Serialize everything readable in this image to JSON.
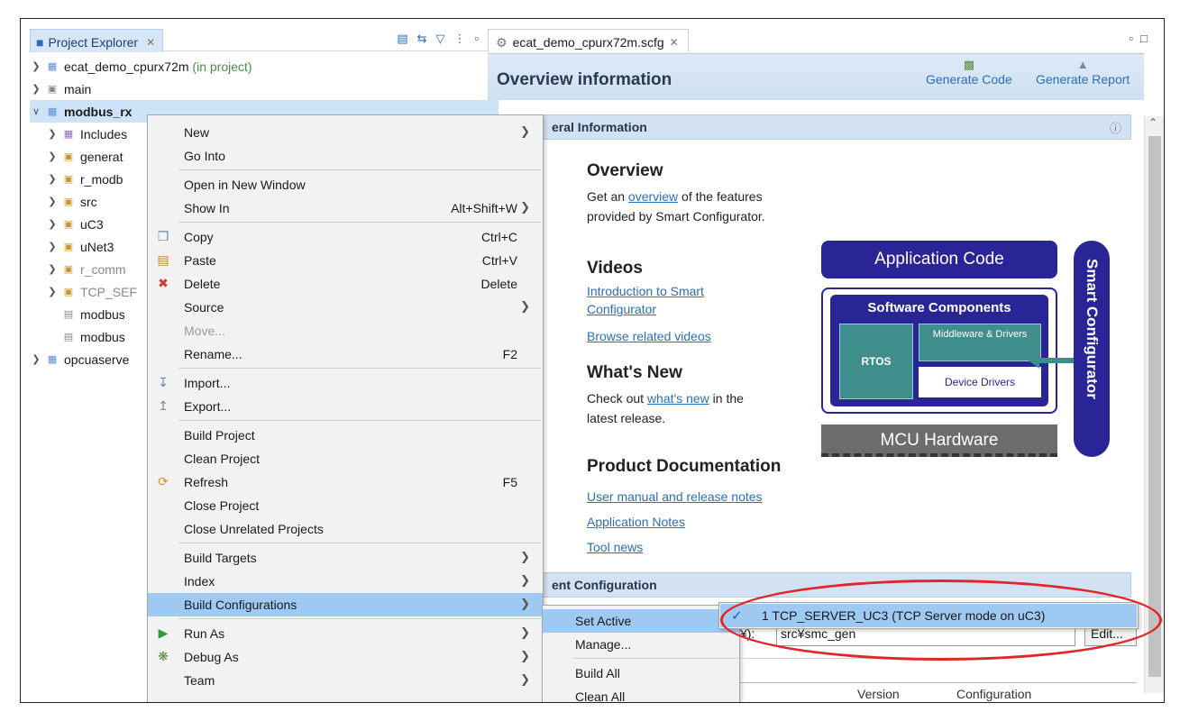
{
  "project_explorer": {
    "tab_label": "Project Explorer",
    "tree": [
      {
        "label": "ecat_demo_cpurx72m",
        "hint": "(in project)",
        "expanded": false
      },
      {
        "label": "main",
        "expanded": false
      },
      {
        "label": "modbus_rx",
        "expanded": true
      },
      {
        "label": "Includes"
      },
      {
        "label": "generat"
      },
      {
        "label": "r_modb"
      },
      {
        "label": "src"
      },
      {
        "label": "uC3"
      },
      {
        "label": "uNet3"
      },
      {
        "label": "r_comm"
      },
      {
        "label": "TCP_SEF"
      },
      {
        "label": "modbus"
      },
      {
        "label": "modbus"
      },
      {
        "label": "opcuaserve"
      }
    ]
  },
  "editor": {
    "tab_label": "ecat_demo_cpurx72m.scfg",
    "title": "Overview information",
    "generate_code": "Generate Code",
    "generate_report": "Generate Report",
    "general_info_label": "eral Information",
    "current_config_label": "ent Configuration",
    "overview": {
      "heading": "Overview",
      "text_pre": "Get an ",
      "link": "overview",
      "text_post": " of the features",
      "text_line2": "provided by Smart Configurator."
    },
    "videos": {
      "heading": "Videos",
      "link1_line1": "Introduction to Smart",
      "link1_line2": "Configurator",
      "link2": "Browse related videos"
    },
    "whats_new": {
      "heading": "What's New",
      "text_pre": "Check out ",
      "link": "what's new",
      "text_post": " in the",
      "text_line2": "latest release."
    },
    "product_docs": {
      "heading": "Product Documentation",
      "link1": "User manual and release notes",
      "link2": "Application Notes",
      "link3": "Tool news"
    },
    "path_label": "¥):",
    "path_value": "src¥smc_gen",
    "edit_button": "Edit...",
    "table_headers": [
      "Version",
      "Configuration"
    ],
    "diagram": {
      "app_code": "Application Code",
      "sw_components": "Software Components",
      "middleware": "Middleware & Drivers",
      "rtos": "RTOS",
      "device_drivers": "Device Drivers",
      "mcu": "MCU Hardware",
      "smart_configurator": "Smart Configurator"
    }
  },
  "context_menu": {
    "items": [
      {
        "label": "New",
        "submenu": true
      },
      {
        "label": "Go Into"
      },
      {
        "label": "Open in New Window"
      },
      {
        "label": "Show In",
        "shortcut": "Alt+Shift+W",
        "submenu": true
      },
      {
        "label": "Copy",
        "shortcut": "Ctrl+C",
        "icon": "copy-icon"
      },
      {
        "label": "Paste",
        "shortcut": "Ctrl+V",
        "icon": "paste-icon"
      },
      {
        "label": "Delete",
        "shortcut": "Delete",
        "icon": "delete-icon"
      },
      {
        "label": "Source",
        "submenu": true
      },
      {
        "label": "Move...",
        "disabled": true
      },
      {
        "label": "Rename...",
        "shortcut": "F2"
      },
      {
        "label": "Import...",
        "icon": "import-icon"
      },
      {
        "label": "Export...",
        "icon": "export-icon"
      },
      {
        "label": "Build Project"
      },
      {
        "label": "Clean Project"
      },
      {
        "label": "Refresh",
        "shortcut": "F5",
        "icon": "refresh-icon"
      },
      {
        "label": "Close Project"
      },
      {
        "label": "Close Unrelated Projects"
      },
      {
        "label": "Build Targets",
        "submenu": true
      },
      {
        "label": "Index",
        "submenu": true
      },
      {
        "label": "Build Configurations",
        "submenu": true,
        "highlighted": true
      },
      {
        "label": "Run As",
        "submenu": true,
        "icon": "run-icon"
      },
      {
        "label": "Debug As",
        "submenu": true,
        "icon": "debug-icon"
      },
      {
        "label": "Team",
        "submenu": true
      }
    ]
  },
  "build_config_menu": {
    "items": [
      {
        "label": "Set Active",
        "highlighted": true
      },
      {
        "label": "Manage..."
      },
      {
        "label": "Build All"
      },
      {
        "label": "Clean All"
      }
    ]
  },
  "set_active_menu": {
    "item": "1 TCP_SERVER_UC3 (TCP Server mode on uC3)",
    "checked": true
  },
  "colors": {
    "highlight": "#9ec9f2",
    "annotation": "#e0262b",
    "diagram_blue": "#2a2596",
    "diagram_teal": "#3e8f8c"
  }
}
